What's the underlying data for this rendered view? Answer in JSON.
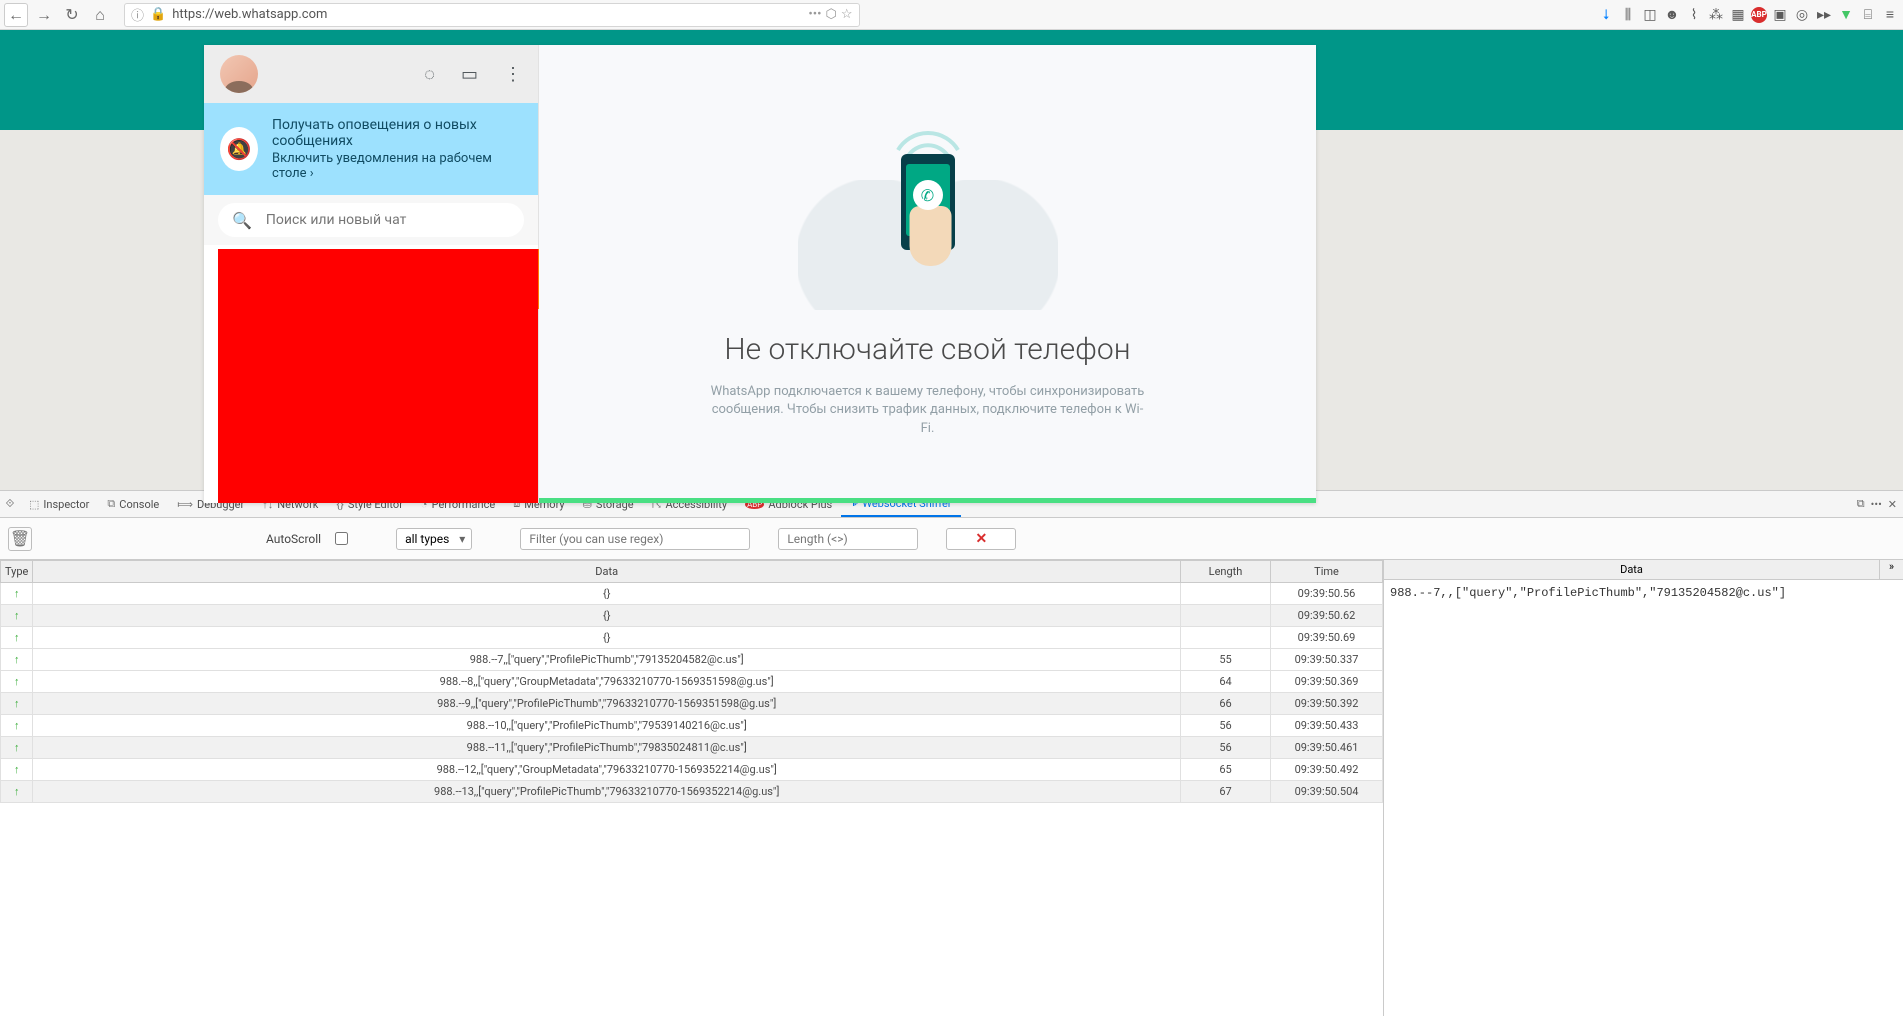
{
  "browser": {
    "url": "https://web.whatsapp.com",
    "url_dots": "•••"
  },
  "wa": {
    "notify_title": "Получать оповещения о новых сообщениях",
    "notify_link": "Включить уведомления на рабочем столе ›",
    "search_placeholder": "Поиск или новый чат",
    "main_title": "Не отключайте свой телефон",
    "main_desc": "WhatsApp подключается к вашему телефону, чтобы синхронизировать сообщения. Чтобы снизить трафик данных, подключите телефон к Wi-Fi."
  },
  "devtools": {
    "tabs": [
      "Inspector",
      "Console",
      "Debugger",
      "Network",
      "Style Editor",
      "Performance",
      "Memory",
      "Storage",
      "Accessibility",
      "Adblock Plus",
      "Websocket Sniffer"
    ]
  },
  "ws": {
    "autoscroll": "AutoScroll",
    "types": "all types",
    "filter_placeholder": "Filter (you can use regex)",
    "length_placeholder": "Length (<>)",
    "clear_glyph": "✕",
    "headers": {
      "type": "Type",
      "data": "Data",
      "length": "Length",
      "time": "Time"
    },
    "rows": [
      {
        "type": "↑",
        "data": "{}",
        "length": "",
        "time": "09:39:50.56",
        "sel": false
      },
      {
        "type": "↑",
        "data": "{}",
        "length": "",
        "time": "09:39:50.62",
        "sel": false
      },
      {
        "type": "↑",
        "data": "{}",
        "length": "",
        "time": "09:39:50.69",
        "sel": false
      },
      {
        "type": "↑",
        "data": "988.--7,,[\"query\",\"ProfilePicThumb\",\"79135204582@c.us\"]",
        "length": "55",
        "time": "09:39:50.337",
        "sel": true
      },
      {
        "type": "↑",
        "data": "988.--8,,[\"query\",\"GroupMetadata\",\"79633210770-1569351598@g.us\"]",
        "length": "64",
        "time": "09:39:50.369",
        "sel": false
      },
      {
        "type": "↑",
        "data": "988.--9,,[\"query\",\"ProfilePicThumb\",\"79633210770-1569351598@g.us\"]",
        "length": "66",
        "time": "09:39:50.392",
        "sel": false
      },
      {
        "type": "↑",
        "data": "988.--10,,[\"query\",\"ProfilePicThumb\",\"79539140216@c.us\"]",
        "length": "56",
        "time": "09:39:50.433",
        "sel": false
      },
      {
        "type": "↑",
        "data": "988.--11,,[\"query\",\"ProfilePicThumb\",\"79835024811@c.us\"]",
        "length": "56",
        "time": "09:39:50.461",
        "sel": false
      },
      {
        "type": "↑",
        "data": "988.--12,,[\"query\",\"GroupMetadata\",\"79633210770-1569352214@g.us\"]",
        "length": "65",
        "time": "09:39:50.492",
        "sel": false
      },
      {
        "type": "↑",
        "data": "988.--13,,[\"query\",\"ProfilePicThumb\",\"79633210770-1569352214@g.us\"]",
        "length": "67",
        "time": "09:39:50.504",
        "sel": false
      }
    ],
    "detail_header": "Data",
    "detail_body": "988.--7,,[\"query\",\"ProfilePicThumb\",\"79135204582@c.us\"]"
  }
}
